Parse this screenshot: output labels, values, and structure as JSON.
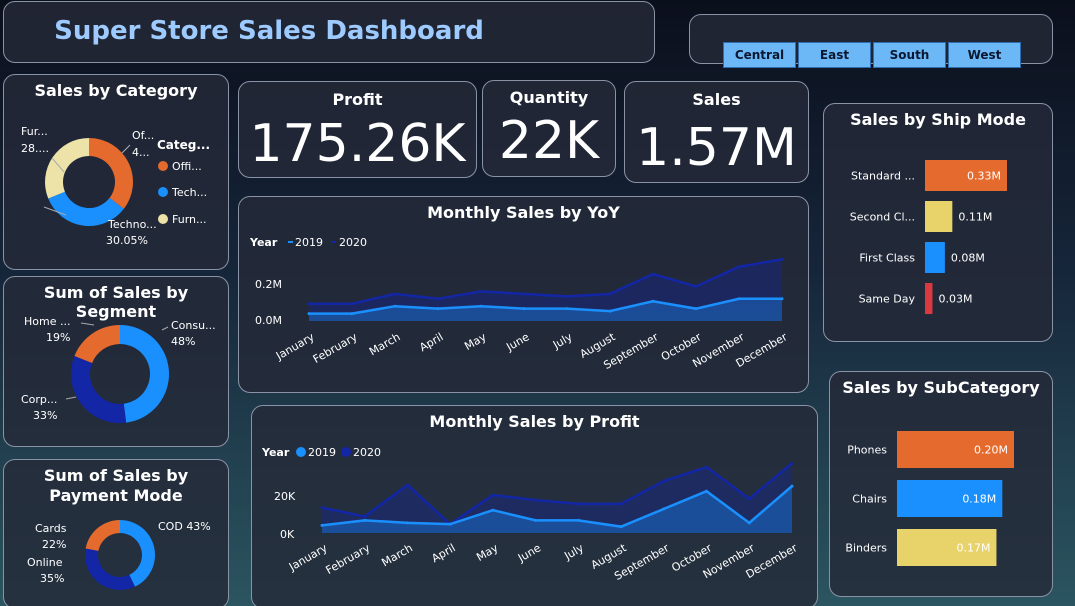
{
  "header": {
    "title": "Super Store Sales Dashboard"
  },
  "region_slicer": {
    "options": [
      "Central",
      "East",
      "South",
      "West"
    ]
  },
  "kpis": {
    "profit": {
      "label": "Profit",
      "value": "175.26K"
    },
    "quantity": {
      "label": "Quantity",
      "value": "22K"
    },
    "sales": {
      "label": "Sales",
      "value": "1.57M"
    }
  },
  "colors": {
    "orange": "#e56a2e",
    "blue": "#1a90ff",
    "navy": "#1226a6",
    "yellow": "#e8d26a",
    "red": "#d9393f",
    "light": "#ede3a8"
  },
  "chart_data": [
    {
      "id": "sales_by_category",
      "type": "pie",
      "title": "Sales by Category",
      "legend_title": "Categ...",
      "legend": [
        "Offi...",
        "Tech...",
        "Furn..."
      ],
      "slices": [
        {
          "label": "Of...",
          "value_label": "4...",
          "value": 31.93,
          "color": "#e56a2e"
        },
        {
          "label": "Techno...",
          "value_label": "30.05%",
          "value": 30.05,
          "color": "#1a90ff"
        },
        {
          "label": "Fur...",
          "value_label": "28....",
          "value": 28.02,
          "color": "#ede3a8"
        }
      ]
    },
    {
      "id": "sum_of_sales_by_segment",
      "type": "pie",
      "title": "Sum of Sales by Segment",
      "slices": [
        {
          "label": "Consu...",
          "value_label": "48%",
          "value": 48,
          "color": "#1a90ff"
        },
        {
          "label": "Corp...",
          "value_label": "33%",
          "value": 33,
          "color": "#1226a6"
        },
        {
          "label": "Home ...",
          "value_label": "19%",
          "value": 19,
          "color": "#e56a2e"
        }
      ]
    },
    {
      "id": "sum_of_sales_by_payment_mode",
      "type": "pie",
      "title": "Sum of Sales by Payment Mode",
      "slices": [
        {
          "label": "COD",
          "value_label": "43%",
          "value": 43,
          "color": "#1a90ff"
        },
        {
          "label": "Online",
          "value_label": "35%",
          "value": 35,
          "color": "#1226a6"
        },
        {
          "label": "Cards",
          "value_label": "22%",
          "value": 22,
          "color": "#e56a2e"
        }
      ]
    },
    {
      "id": "monthly_sales_by_yoy",
      "type": "area",
      "title": "Monthly Sales by YoY",
      "legend_title": "Year",
      "categories": [
        "January",
        "February",
        "March",
        "April",
        "May",
        "June",
        "July",
        "August",
        "September",
        "October",
        "November",
        "December"
      ],
      "yticks": [
        "0.0M",
        "0.2M"
      ],
      "ylim": [
        0,
        0.3
      ],
      "series": [
        {
          "name": "2019",
          "color": "#1a90ff",
          "values": [
            0.03,
            0.03,
            0.06,
            0.05,
            0.06,
            0.05,
            0.05,
            0.04,
            0.08,
            0.05,
            0.09,
            0.09
          ]
        },
        {
          "name": "2020",
          "color": "#1226a6",
          "values": [
            0.07,
            0.07,
            0.11,
            0.09,
            0.12,
            0.11,
            0.1,
            0.11,
            0.19,
            0.14,
            0.22,
            0.25
          ]
        }
      ]
    },
    {
      "id": "monthly_sales_by_profit",
      "type": "area",
      "title": "Monthly Sales by Profit",
      "legend_title": "Year",
      "categories": [
        "January",
        "February",
        "March",
        "April",
        "May",
        "June",
        "July",
        "August",
        "September",
        "October",
        "November",
        "December"
      ],
      "yticks": [
        "0K",
        "20K"
      ],
      "ylim": [
        0,
        30000
      ],
      "series": [
        {
          "name": "2019",
          "color": "#1a90ff",
          "values": [
            3000,
            5000,
            4000,
            3500,
            9000,
            5000,
            5000,
            2500,
            9500,
            16500,
            4000,
            18500
          ]
        },
        {
          "name": "2020",
          "color": "#1226a6",
          "values": [
            10000,
            6500,
            19000,
            3500,
            15000,
            13000,
            11500,
            11500,
            20500,
            26000,
            13500,
            27500
          ]
        }
      ]
    },
    {
      "id": "sales_by_ship_mode",
      "type": "bar",
      "title": "Sales by Ship Mode",
      "categories": [
        "Standard ...",
        "Second Cl...",
        "First Class",
        "Same Day"
      ],
      "values": [
        0.33,
        0.11,
        0.08,
        0.03
      ],
      "value_labels": [
        "0.33M",
        "0.11M",
        "0.08M",
        "0.03M"
      ],
      "colors": [
        "#e56a2e",
        "#e8d26a",
        "#1a90ff",
        "#d9393f"
      ]
    },
    {
      "id": "sales_by_subcategory",
      "type": "bar",
      "title": "Sales by SubCategory",
      "categories": [
        "Phones",
        "Chairs",
        "Binders"
      ],
      "values": [
        0.2,
        0.18,
        0.17
      ],
      "value_labels": [
        "0.20M",
        "0.18M",
        "0.17M"
      ],
      "colors": [
        "#e56a2e",
        "#1a90ff",
        "#e8d26a"
      ]
    }
  ]
}
